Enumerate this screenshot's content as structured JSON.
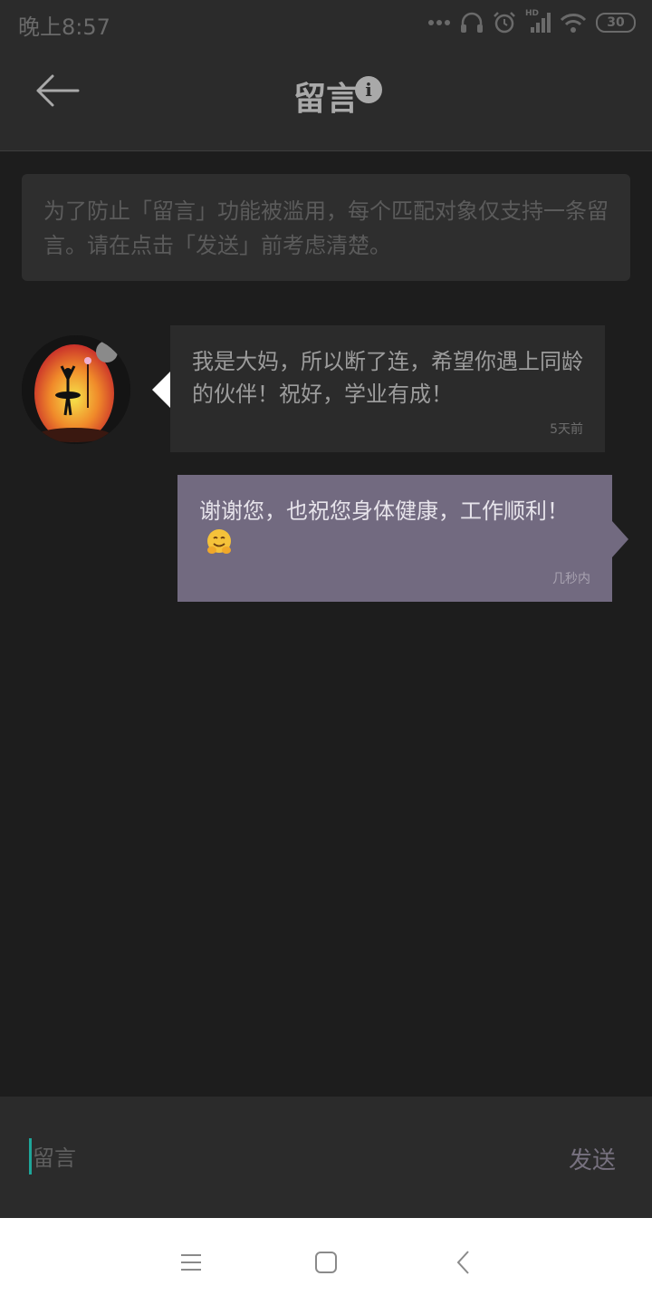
{
  "status_bar": {
    "time": "晚上8:57",
    "network_badge": "HD",
    "battery": "30"
  },
  "header": {
    "title": "留言",
    "info_glyph": "i",
    "back_icon": "arrow-left-icon"
  },
  "notice": {
    "text": "为了防止「留言」功能被滥用，每个匹配对象仅支持一条留言。请在点击「发送」前考虑清楚。"
  },
  "messages": [
    {
      "direction": "incoming",
      "text": "我是大妈，所以断了连，希望你遇上同龄的伙伴！祝好，学业有成！",
      "time": "5天前"
    },
    {
      "direction": "outgoing",
      "text": "谢谢您，也祝您身体健康，工作顺利！",
      "emoji": "hugging-face-emoji",
      "time": "几秒内"
    }
  ],
  "composer": {
    "placeholder": "留言",
    "value": "",
    "send_label": "发送"
  },
  "nav_bar": {
    "icons": [
      "menu-icon",
      "home-square-icon",
      "back-chevron-icon"
    ]
  },
  "colors": {
    "background": "#1d1d1d",
    "bar": "#2b2b2b",
    "outgoing_bubble": "#726a80",
    "caret": "#1ea69a"
  }
}
